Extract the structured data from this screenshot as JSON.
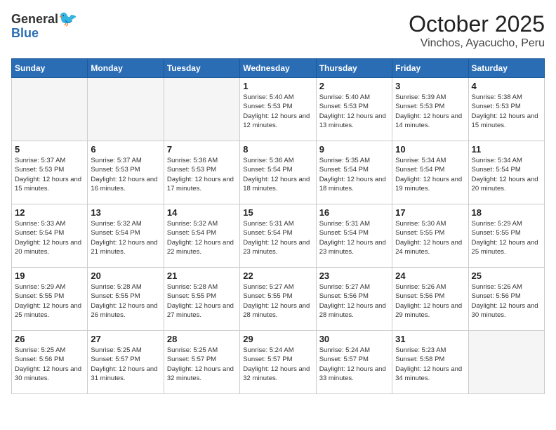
{
  "header": {
    "logo_general": "General",
    "logo_blue": "Blue",
    "month": "October 2025",
    "location": "Vinchos, Ayacucho, Peru"
  },
  "weekdays": [
    "Sunday",
    "Monday",
    "Tuesday",
    "Wednesday",
    "Thursday",
    "Friday",
    "Saturday"
  ],
  "weeks": [
    [
      {
        "day": "",
        "info": ""
      },
      {
        "day": "",
        "info": ""
      },
      {
        "day": "",
        "info": ""
      },
      {
        "day": "1",
        "info": "Sunrise: 5:40 AM\nSunset: 5:53 PM\nDaylight: 12 hours\nand 12 minutes."
      },
      {
        "day": "2",
        "info": "Sunrise: 5:40 AM\nSunset: 5:53 PM\nDaylight: 12 hours\nand 13 minutes."
      },
      {
        "day": "3",
        "info": "Sunrise: 5:39 AM\nSunset: 5:53 PM\nDaylight: 12 hours\nand 14 minutes."
      },
      {
        "day": "4",
        "info": "Sunrise: 5:38 AM\nSunset: 5:53 PM\nDaylight: 12 hours\nand 15 minutes."
      }
    ],
    [
      {
        "day": "5",
        "info": "Sunrise: 5:37 AM\nSunset: 5:53 PM\nDaylight: 12 hours\nand 15 minutes."
      },
      {
        "day": "6",
        "info": "Sunrise: 5:37 AM\nSunset: 5:53 PM\nDaylight: 12 hours\nand 16 minutes."
      },
      {
        "day": "7",
        "info": "Sunrise: 5:36 AM\nSunset: 5:53 PM\nDaylight: 12 hours\nand 17 minutes."
      },
      {
        "day": "8",
        "info": "Sunrise: 5:36 AM\nSunset: 5:54 PM\nDaylight: 12 hours\nand 18 minutes."
      },
      {
        "day": "9",
        "info": "Sunrise: 5:35 AM\nSunset: 5:54 PM\nDaylight: 12 hours\nand 18 minutes."
      },
      {
        "day": "10",
        "info": "Sunrise: 5:34 AM\nSunset: 5:54 PM\nDaylight: 12 hours\nand 19 minutes."
      },
      {
        "day": "11",
        "info": "Sunrise: 5:34 AM\nSunset: 5:54 PM\nDaylight: 12 hours\nand 20 minutes."
      }
    ],
    [
      {
        "day": "12",
        "info": "Sunrise: 5:33 AM\nSunset: 5:54 PM\nDaylight: 12 hours\nand 20 minutes."
      },
      {
        "day": "13",
        "info": "Sunrise: 5:32 AM\nSunset: 5:54 PM\nDaylight: 12 hours\nand 21 minutes."
      },
      {
        "day": "14",
        "info": "Sunrise: 5:32 AM\nSunset: 5:54 PM\nDaylight: 12 hours\nand 22 minutes."
      },
      {
        "day": "15",
        "info": "Sunrise: 5:31 AM\nSunset: 5:54 PM\nDaylight: 12 hours\nand 23 minutes."
      },
      {
        "day": "16",
        "info": "Sunrise: 5:31 AM\nSunset: 5:54 PM\nDaylight: 12 hours\nand 23 minutes."
      },
      {
        "day": "17",
        "info": "Sunrise: 5:30 AM\nSunset: 5:55 PM\nDaylight: 12 hours\nand 24 minutes."
      },
      {
        "day": "18",
        "info": "Sunrise: 5:29 AM\nSunset: 5:55 PM\nDaylight: 12 hours\nand 25 minutes."
      }
    ],
    [
      {
        "day": "19",
        "info": "Sunrise: 5:29 AM\nSunset: 5:55 PM\nDaylight: 12 hours\nand 25 minutes."
      },
      {
        "day": "20",
        "info": "Sunrise: 5:28 AM\nSunset: 5:55 PM\nDaylight: 12 hours\nand 26 minutes."
      },
      {
        "day": "21",
        "info": "Sunrise: 5:28 AM\nSunset: 5:55 PM\nDaylight: 12 hours\nand 27 minutes."
      },
      {
        "day": "22",
        "info": "Sunrise: 5:27 AM\nSunset: 5:55 PM\nDaylight: 12 hours\nand 28 minutes."
      },
      {
        "day": "23",
        "info": "Sunrise: 5:27 AM\nSunset: 5:56 PM\nDaylight: 12 hours\nand 28 minutes."
      },
      {
        "day": "24",
        "info": "Sunrise: 5:26 AM\nSunset: 5:56 PM\nDaylight: 12 hours\nand 29 minutes."
      },
      {
        "day": "25",
        "info": "Sunrise: 5:26 AM\nSunset: 5:56 PM\nDaylight: 12 hours\nand 30 minutes."
      }
    ],
    [
      {
        "day": "26",
        "info": "Sunrise: 5:25 AM\nSunset: 5:56 PM\nDaylight: 12 hours\nand 30 minutes."
      },
      {
        "day": "27",
        "info": "Sunrise: 5:25 AM\nSunset: 5:57 PM\nDaylight: 12 hours\nand 31 minutes."
      },
      {
        "day": "28",
        "info": "Sunrise: 5:25 AM\nSunset: 5:57 PM\nDaylight: 12 hours\nand 32 minutes."
      },
      {
        "day": "29",
        "info": "Sunrise: 5:24 AM\nSunset: 5:57 PM\nDaylight: 12 hours\nand 32 minutes."
      },
      {
        "day": "30",
        "info": "Sunrise: 5:24 AM\nSunset: 5:57 PM\nDaylight: 12 hours\nand 33 minutes."
      },
      {
        "day": "31",
        "info": "Sunrise: 5:23 AM\nSunset: 5:58 PM\nDaylight: 12 hours\nand 34 minutes."
      },
      {
        "day": "",
        "info": ""
      }
    ]
  ]
}
